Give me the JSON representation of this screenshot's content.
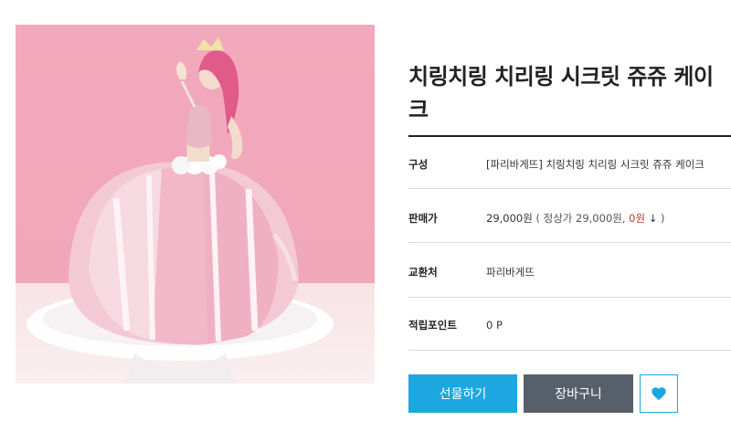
{
  "product": {
    "title": "치링치링 치리링 시크릿 쥬쥬 케이크",
    "image_alt": "pink dome princess cake topped with a Secret Jouju figure"
  },
  "info": {
    "composition_label": "구성",
    "composition_value": "[파리바게뜨] 치링치링 치리링 시크릿 쥬쥬 케이크",
    "price_label": "판매가",
    "price_value": "29,000원",
    "price_detail_prefix": "( 정상가 29,000원, ",
    "price_discount": "0원",
    "price_arrow": "↓",
    "price_detail_suffix": " )",
    "exchange_label": "교환처",
    "exchange_value": "파리바게뜨",
    "points_label": "적립포인트",
    "points_value": "0 P"
  },
  "actions": {
    "gift_label": "선물하기",
    "cart_label": "장바구니",
    "wish_icon": "heart-icon"
  },
  "colors": {
    "gift_button": "#1da7e0",
    "cart_button": "#575f6a",
    "wish_border": "#1da7e0",
    "heart": "#1da7e0",
    "discount": "#c0392b"
  }
}
